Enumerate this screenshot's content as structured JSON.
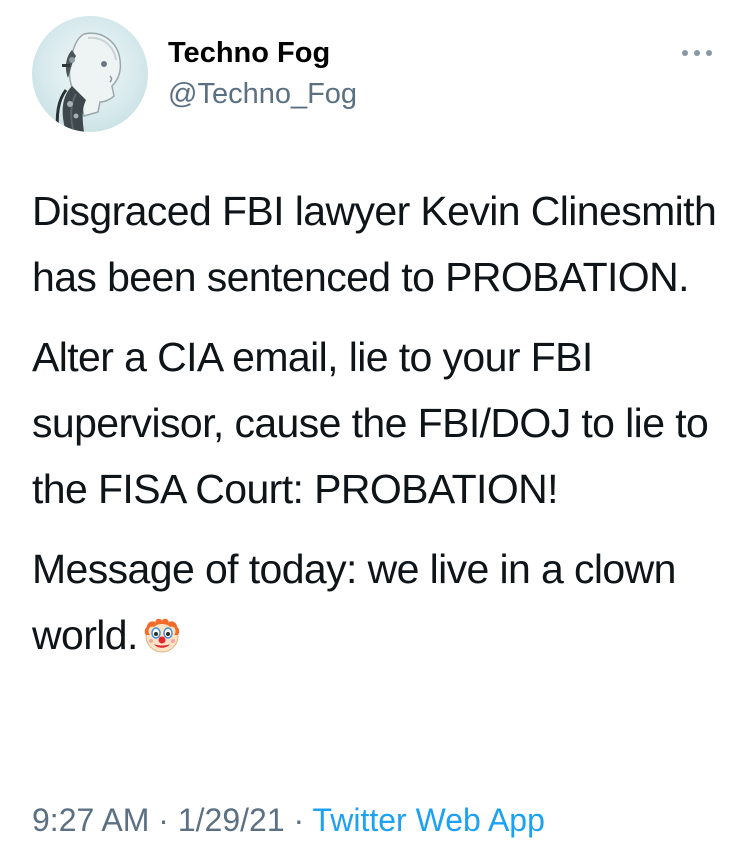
{
  "tweet": {
    "display_name": "Techno Fog",
    "handle": "@Techno_Fog",
    "paragraphs": [
      "Disgraced FBI lawyer Kevin Clinesmith has been sentenced to PROBATION.",
      "Alter a CIA email, lie to your FBI supervisor, cause the FBI/DOJ to lie to the FISA Court: PROBATION!",
      "Message of today: we live in a clown world."
    ],
    "emoji": "clown-face-emoji",
    "time": "9:27 AM",
    "date": "1/29/21",
    "separator": "·",
    "source": "Twitter Web App",
    "more_icon": "more-horizontal-icon"
  },
  "colors": {
    "text": "#0f1419",
    "secondary": "#5b7083",
    "link": "#1da1f2",
    "background": "#ffffff"
  }
}
